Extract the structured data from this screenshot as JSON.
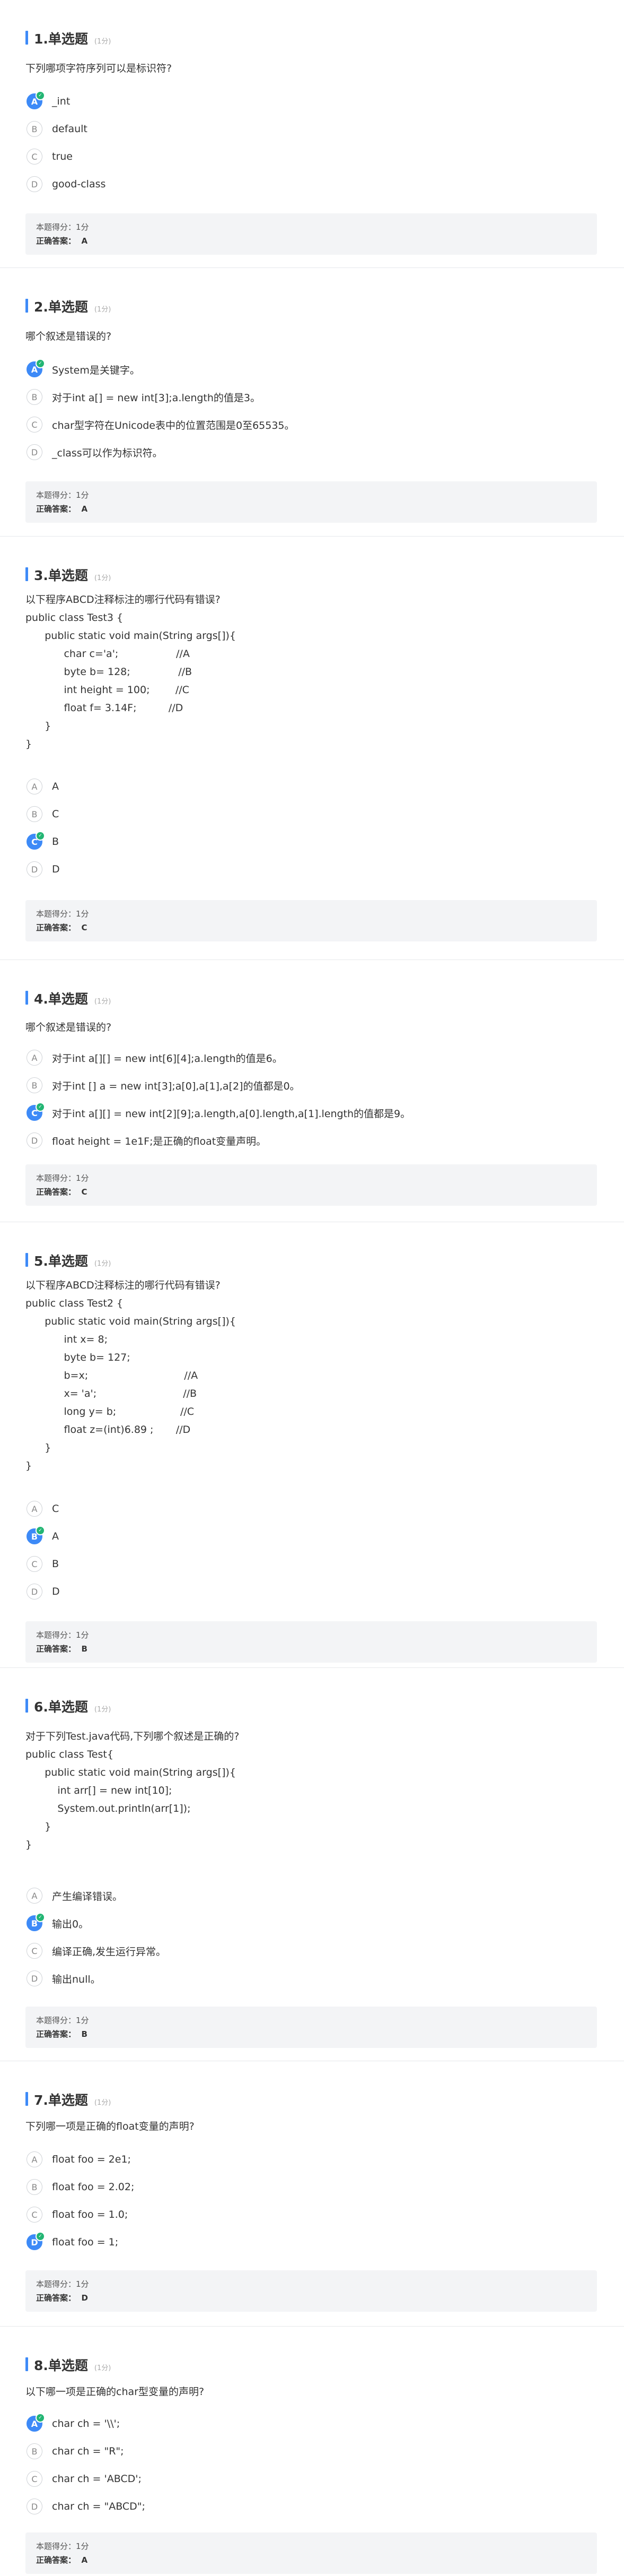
{
  "accent": "#3d8af7",
  "correct_color": "#22b573",
  "labels": {
    "score": "本题得分：",
    "answer": "正确答案："
  },
  "questions": [
    {
      "title": "1.单选题",
      "points": "(1分)",
      "stem": "下列哪项字符序列可以是标识符?",
      "options": [
        {
          "letter": "A",
          "text": "_int"
        },
        {
          "letter": "B",
          "text": "default"
        },
        {
          "letter": "C",
          "text": "true"
        },
        {
          "letter": "D",
          "text": "good-class"
        }
      ],
      "selected": "A",
      "score": "1分",
      "answer": "A"
    },
    {
      "title": "2.单选题",
      "points": "(1分)",
      "stem": "哪个叙述是错误的?",
      "options": [
        {
          "letter": "A",
          "text": "System是关键字。"
        },
        {
          "letter": "B",
          "text": "对于int a[] = new int[3];a.length的值是3。"
        },
        {
          "letter": "C",
          "text": "char型字符在Unicode表中的位置范围是0至65535。"
        },
        {
          "letter": "D",
          "text": "_class可以作为标识符。"
        }
      ],
      "selected": "A",
      "score": "1分",
      "answer": "A"
    },
    {
      "title": "3.单选题",
      "points": "(1分)",
      "stem": "以下程序ABCD注释标注的哪行代码有错误?\npublic class Test3 {\n      public static void main(String args[]){\n            char c='a';                  //A\n            byte b= 128;               //B\n            int height = 100;        //C\n            float f= 3.14F;          //D\n      }\n}",
      "options": [
        {
          "letter": "A",
          "text": "A"
        },
        {
          "letter": "B",
          "text": "C"
        },
        {
          "letter": "C",
          "text": "B"
        },
        {
          "letter": "D",
          "text": "D"
        }
      ],
      "selected": "C",
      "score": "1分",
      "answer": "C"
    },
    {
      "title": "4.单选题",
      "points": "(1分)",
      "stem": "哪个叙述是错误的?",
      "options": [
        {
          "letter": "A",
          "text": "对于int a[][] = new int[6][4];a.length的值是6。"
        },
        {
          "letter": "B",
          "text": "对于int [] a = new int[3];a[0],a[1],a[2]的值都是0。"
        },
        {
          "letter": "C",
          "text": "对于int a[][] = new int[2][9];a.length,a[0].length,a[1].length的值都是9。"
        },
        {
          "letter": "D",
          "text": "float height = 1e1F;是正确的float变量声明。"
        }
      ],
      "selected": "C",
      "score": "1分",
      "answer": "C"
    },
    {
      "title": "5.单选题",
      "points": "(1分)",
      "stem": "以下程序ABCD注释标注的哪行代码有错误?\npublic class Test2 {\n      public static void main(String args[]){\n            int x= 8;\n            byte b= 127;\n            b=x;                              //A\n            x= 'a';                           //B\n            long y= b;                    //C\n            float z=(int)6.89 ;       //D\n      }\n}",
      "options": [
        {
          "letter": "A",
          "text": "C"
        },
        {
          "letter": "B",
          "text": "A"
        },
        {
          "letter": "C",
          "text": "B"
        },
        {
          "letter": "D",
          "text": "D"
        }
      ],
      "selected": "B",
      "score": "1分",
      "answer": "B"
    },
    {
      "title": "6.单选题",
      "points": "(1分)",
      "stem": "对于下列Test.java代码,下列哪个叙述是正确的?\npublic class Test{\n      public static void main(String args[]){\n          int arr[] = new int[10];\n          System.out.println(arr[1]);\n      }\n}",
      "options": [
        {
          "letter": "A",
          "text": "产生编译错误。"
        },
        {
          "letter": "B",
          "text": "输出0。"
        },
        {
          "letter": "C",
          "text": "编译正确,发生运行异常。"
        },
        {
          "letter": "D",
          "text": "输出null。"
        }
      ],
      "selected": "B",
      "score": "1分",
      "answer": "B"
    },
    {
      "title": "7.单选题",
      "points": "(1分)",
      "stem": "下列哪一项是正确的float变量的声明?",
      "options": [
        {
          "letter": "A",
          "text": "float foo = 2e1;"
        },
        {
          "letter": "B",
          "text": "float foo = 2.02;"
        },
        {
          "letter": "C",
          "text": "float foo = 1.0;"
        },
        {
          "letter": "D",
          "text": "float foo = 1;"
        }
      ],
      "selected": "D",
      "score": "1分",
      "answer": "D"
    },
    {
      "title": "8.单选题",
      "points": "(1分)",
      "stem": "以下哪一项是正确的char型变量的声明?",
      "options": [
        {
          "letter": "A",
          "text": "char ch = '\\\\';"
        },
        {
          "letter": "B",
          "text": "char ch = \"R\";"
        },
        {
          "letter": "C",
          "text": "char ch = 'ABCD';"
        },
        {
          "letter": "D",
          "text": "char ch = \"ABCD\";"
        }
      ],
      "selected": "A",
      "score": "1分",
      "answer": "A"
    }
  ]
}
